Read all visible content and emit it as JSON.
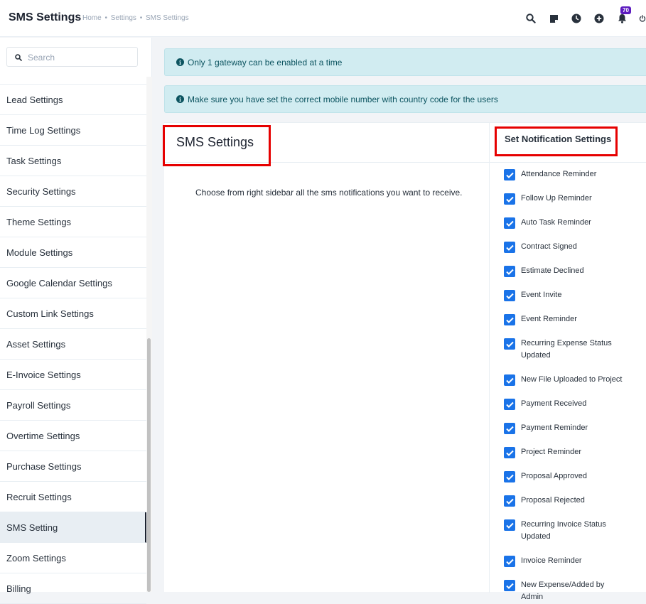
{
  "header": {
    "title": "SMS Settings",
    "breadcrumb": [
      "Home",
      "•",
      "Settings",
      "•",
      "SMS Settings"
    ],
    "notification_count": "70",
    "icons": [
      "search-icon",
      "sticky-note-icon",
      "clock-icon",
      "add-circle-icon",
      "bell-icon",
      "power-icon"
    ]
  },
  "sidebar": {
    "search_placeholder": "Search",
    "items": [
      {
        "label": "Lead Settings"
      },
      {
        "label": "Time Log Settings"
      },
      {
        "label": "Task Settings"
      },
      {
        "label": "Security Settings"
      },
      {
        "label": "Theme Settings"
      },
      {
        "label": "Module Settings"
      },
      {
        "label": "Google Calendar Settings"
      },
      {
        "label": "Custom Link Settings"
      },
      {
        "label": "Asset Settings"
      },
      {
        "label": "E-Invoice Settings"
      },
      {
        "label": "Payroll Settings"
      },
      {
        "label": "Overtime Settings"
      },
      {
        "label": "Purchase Settings"
      },
      {
        "label": "Recruit Settings"
      },
      {
        "label": "SMS Setting",
        "active": true
      },
      {
        "label": "Zoom Settings"
      },
      {
        "label": "Billing"
      }
    ]
  },
  "alerts": [
    "Only 1 gateway can be enabled at a time",
    "Make sure you have set the correct mobile number with country code for the users"
  ],
  "main": {
    "title": "SMS Settings",
    "description": "Choose from right sidebar all the sms notifications you want to receive."
  },
  "notifications": {
    "title": "Set Notification Settings",
    "items": [
      {
        "label": "Attendance Reminder",
        "checked": true
      },
      {
        "label": "Follow Up Reminder",
        "checked": true
      },
      {
        "label": "Auto Task Reminder",
        "checked": true
      },
      {
        "label": "Contract Signed",
        "checked": true
      },
      {
        "label": "Estimate Declined",
        "checked": true
      },
      {
        "label": "Event Invite",
        "checked": true
      },
      {
        "label": "Event Reminder",
        "checked": true
      },
      {
        "label": "Recurring Expense Status Updated",
        "checked": true
      },
      {
        "label": "New File Uploaded to Project",
        "checked": true
      },
      {
        "label": "Payment Received",
        "checked": true
      },
      {
        "label": "Payment Reminder",
        "checked": true
      },
      {
        "label": "Project Reminder",
        "checked": true
      },
      {
        "label": "Proposal Approved",
        "checked": true
      },
      {
        "label": "Proposal Rejected",
        "checked": true
      },
      {
        "label": "Recurring Invoice Status Updated",
        "checked": true
      },
      {
        "label": "Invoice Reminder",
        "checked": true
      },
      {
        "label": "New Expense/Added by Admin",
        "checked": true
      }
    ]
  },
  "colors": {
    "accent": "#1a73e8",
    "highlight_box": "#e60000",
    "alert_bg": "#d1ecf1",
    "badge": "#5c1bbf"
  }
}
